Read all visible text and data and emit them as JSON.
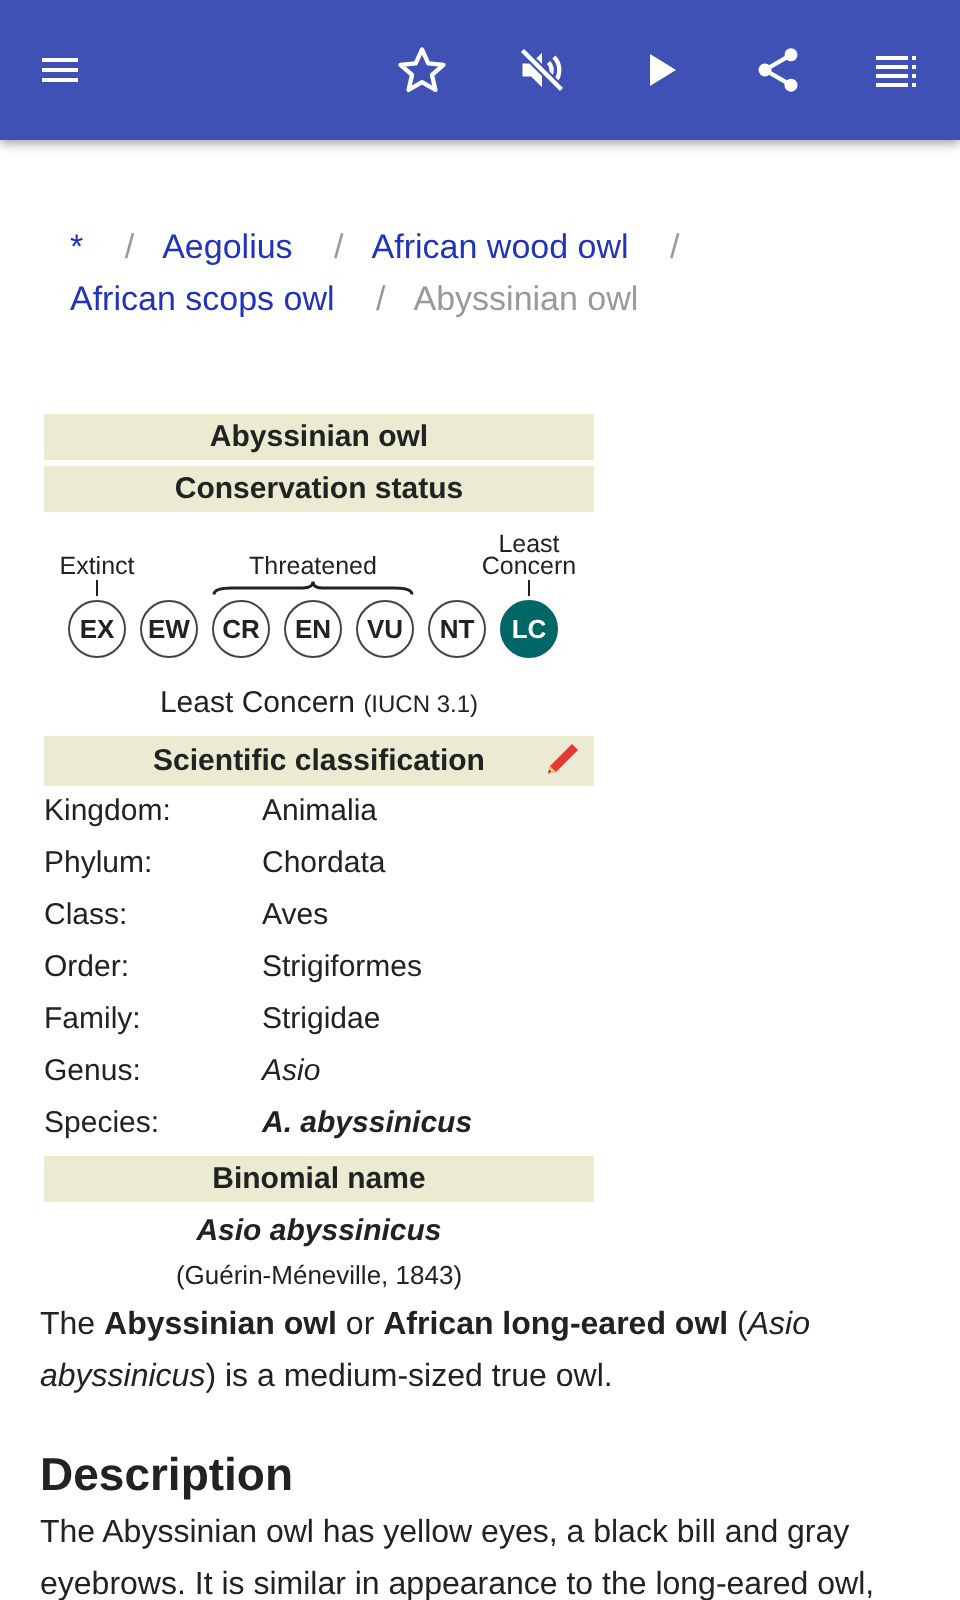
{
  "breadcrumbs": [
    {
      "label": "*",
      "current": false,
      "separator": "/"
    },
    {
      "label": "Aegolius",
      "current": false,
      "separator": "/"
    },
    {
      "label": "African wood owl",
      "current": false,
      "separator": "/"
    },
    {
      "label": "African scops owl",
      "current": false,
      "separator": "/"
    },
    {
      "label": "Abyssinian owl",
      "current": true
    }
  ],
  "infobox": {
    "title": "Abyssinian owl",
    "conservation": {
      "heading": "Conservation status",
      "groups": [
        {
          "label": "Extinct",
          "kind": "tick",
          "statuses": [
            {
              "code": "EX",
              "selected": false
            }
          ]
        },
        {
          "kind": "none",
          "statuses": [
            {
              "code": "EW",
              "selected": false
            }
          ]
        },
        {
          "label": "Threatened",
          "kind": "brace",
          "statuses": [
            {
              "code": "CR",
              "selected": false
            },
            {
              "code": "EN",
              "selected": false
            },
            {
              "code": "VU",
              "selected": false
            }
          ]
        },
        {
          "kind": "none",
          "statuses": [
            {
              "code": "NT",
              "selected": false
            }
          ]
        },
        {
          "label": "Least Concern",
          "kind": "tick",
          "statuses": [
            {
              "code": "LC",
              "selected": true
            }
          ]
        }
      ],
      "status": "Least Concern",
      "assessment": "(IUCN 3.1)"
    },
    "classification": {
      "heading": "Scientific classification",
      "rows": [
        {
          "label": "Kingdom:",
          "value": "Animalia",
          "kind": "plain"
        },
        {
          "label": "Phylum:",
          "value": "Chordata",
          "kind": "plain"
        },
        {
          "label": "Class:",
          "value": "Aves",
          "kind": "plain"
        },
        {
          "label": "Order:",
          "value": "Strigiformes",
          "kind": "plain"
        },
        {
          "label": "Family:",
          "value": "Strigidae",
          "kind": "plain"
        },
        {
          "label": "Genus:",
          "value": "Asio",
          "kind": "italic"
        },
        {
          "label": "Species:",
          "value": "A. abyssinicus",
          "kind": "bold-italic"
        }
      ]
    },
    "binomial": {
      "heading": "Binomial name",
      "name": "Asio abyssinicus",
      "authority": "(Guérin-Méneville, 1843)"
    }
  },
  "intro": "The **Abyssinian owl** or **African long-eared owl** (*Asio abyssinicus*) is a medium-sized true owl.",
  "sections": [
    {
      "heading": "Description",
      "text": "The Abyssinian owl has yellow eyes, a black bill and gray eyebrows. It is similar in appearance to the long-eared owl,"
    }
  ]
}
